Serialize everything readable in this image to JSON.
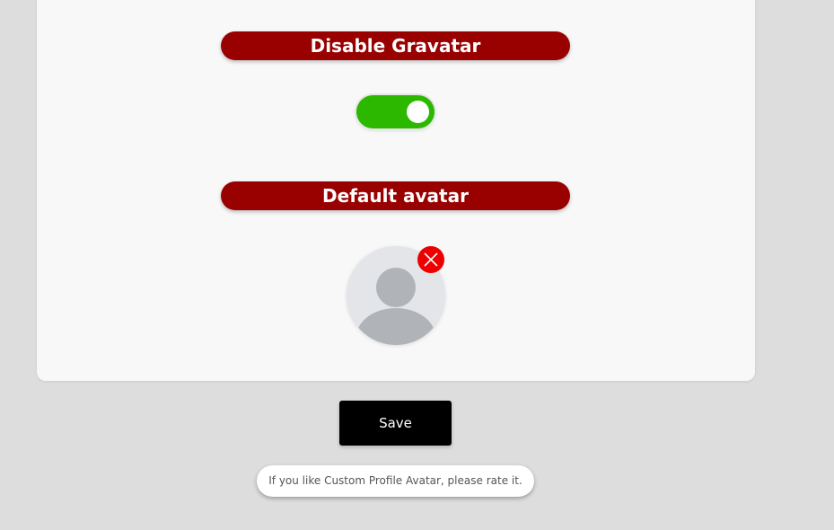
{
  "settings": {
    "disable_gravatar": {
      "title": "Disable Gravatar",
      "enabled": true
    },
    "default_avatar": {
      "title": "Default avatar",
      "image_icon": "person-placeholder-icon",
      "remove_icon": "close-icon"
    }
  },
  "actions": {
    "save_label": "Save"
  },
  "footer": {
    "rate_message": "If you like Custom Profile Avatar, please rate it."
  },
  "colors": {
    "page_background": "#dddddd",
    "card_background": "#f8f8f8",
    "section_title_background": "#990000",
    "toggle_on": "#2db800",
    "remove_button": "#ee0000",
    "save_button": "#000000"
  }
}
